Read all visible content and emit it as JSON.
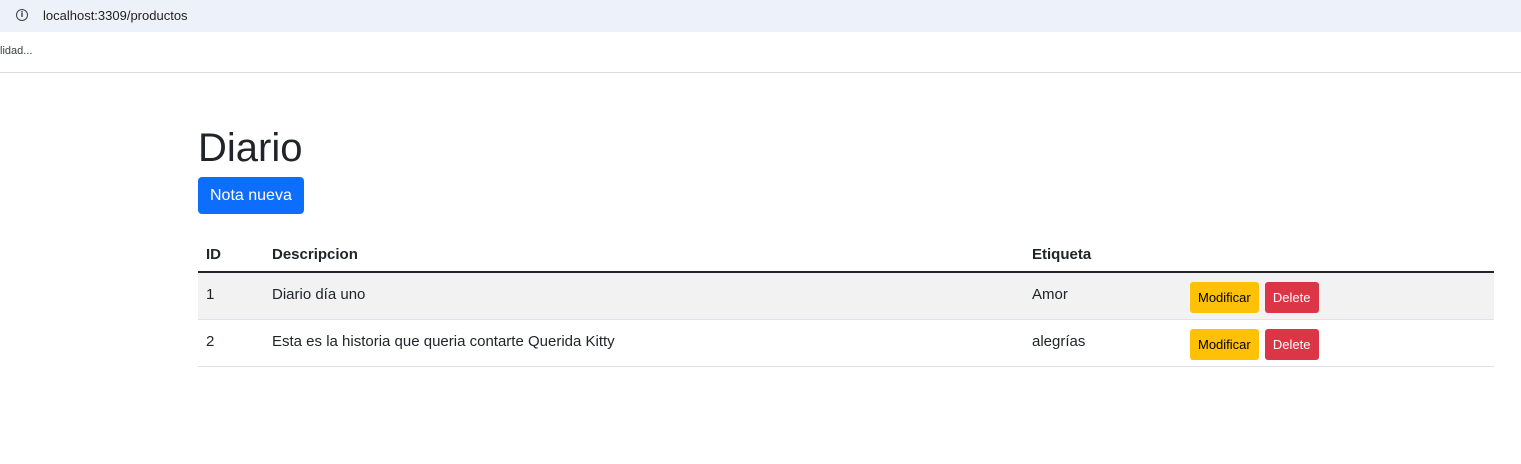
{
  "browser": {
    "url": "localhost:3309/productos",
    "bookmark_text": "lidad..."
  },
  "page": {
    "title": "Diario",
    "new_button_label": "Nota nueva"
  },
  "table": {
    "headers": [
      "ID",
      "Descripcion",
      "Etiqueta",
      ""
    ],
    "rows": [
      {
        "id": "1",
        "descripcion": "Diario día uno",
        "etiqueta": "Amor"
      },
      {
        "id": "2",
        "descripcion": "Esta es la historia que queria contarte Querida Kitty",
        "etiqueta": "alegrías"
      }
    ],
    "modify_label": "Modificar",
    "delete_label": "Delete"
  },
  "colors": {
    "primary": "#0d6efd",
    "warning": "#ffc107",
    "danger": "#dc3545",
    "stripe": "#f2f2f2",
    "addressbar": "#edf2fa"
  }
}
